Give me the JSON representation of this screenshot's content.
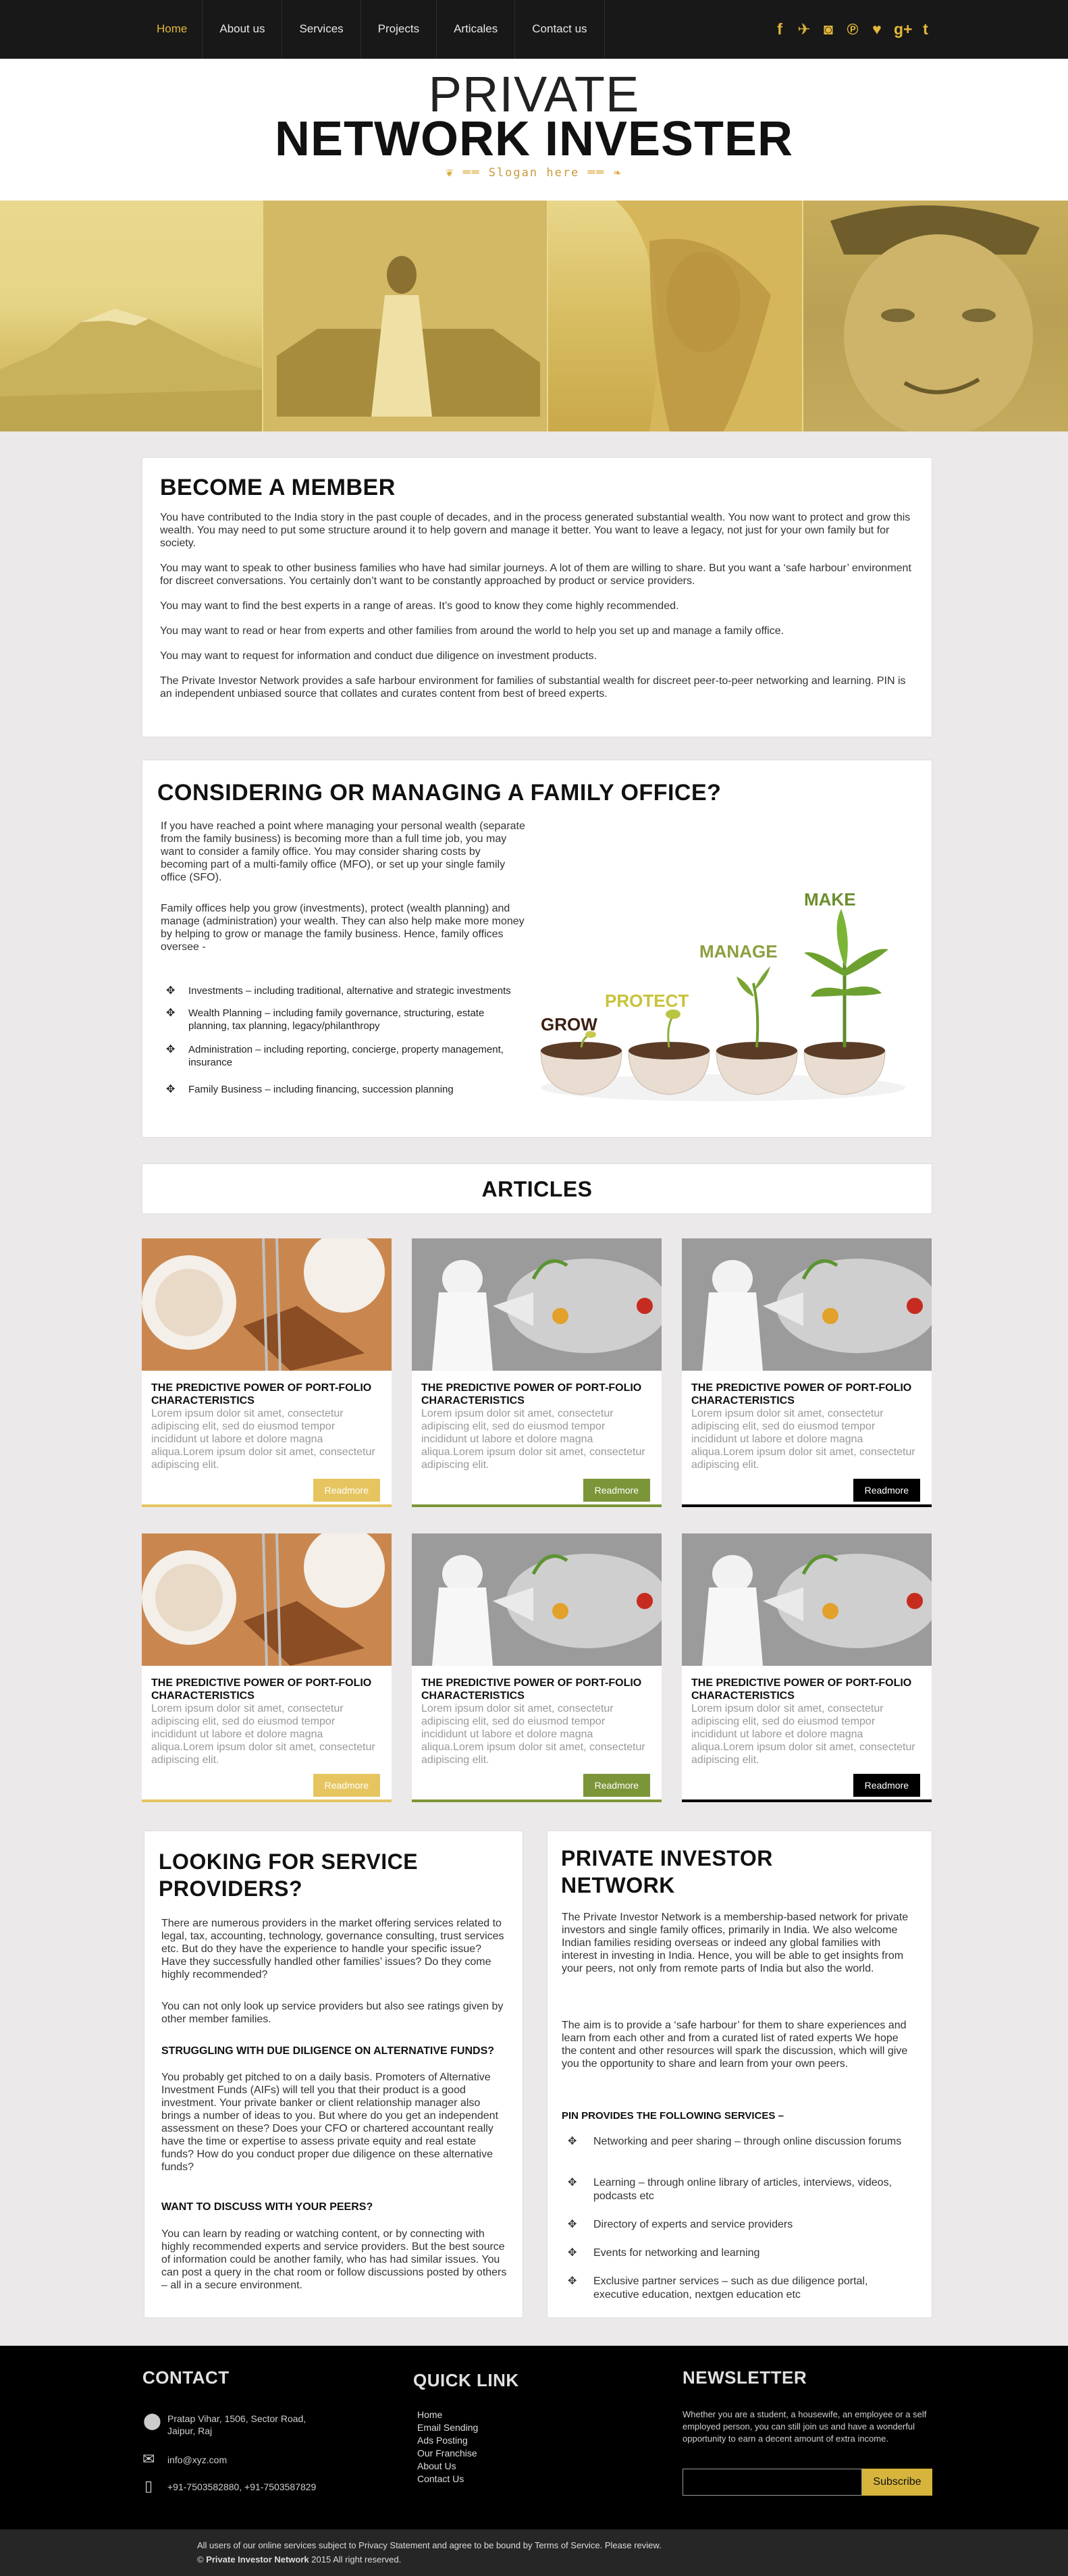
{
  "nav": {
    "items": [
      "Home",
      "About us",
      "Services",
      "Projects",
      "Articales",
      "Contact us"
    ]
  },
  "social": [
    {
      "icon": "facebook-icon",
      "glyph": "f"
    },
    {
      "icon": "twitter-icon",
      "glyph": "✈"
    },
    {
      "icon": "instagram-icon",
      "glyph": "◙"
    },
    {
      "icon": "pinterest-icon",
      "glyph": "℗"
    },
    {
      "icon": "heart-icon",
      "glyph": "♥"
    },
    {
      "icon": "google-plus-icon",
      "glyph": "g+"
    },
    {
      "icon": "tumblr-icon",
      "glyph": "t"
    }
  ],
  "header": {
    "brand_top": "PRIVATE",
    "brand_bottom": "NETWORK INVESTER",
    "slogan": "Slogan here"
  },
  "member": {
    "title": "BECOME A MEMBER",
    "paragraphs": [
      "You have contributed to the India story in the past couple of decades, and in the process generated substantial wealth. You now want to protect and grow this wealth. You may need to put some structure around it to help govern and manage it better. You want to leave a legacy, not just for your own family but for society.",
      "You may want to speak to other business families who have had similar journeys. A lot of them are willing to share. But you want a ‘safe harbour’ environment for discreet conversations. You certainly don’t want to be constantly approached by product or service providers.",
      "You may want to find the best experts in a range of areas. It’s good to know they come highly recommended.",
      "You may want to read or hear from experts and other families from around the world to help you set up and manage a family office.",
      "You may want to request for information and conduct due diligence on investment products.",
      "The Private Investor Network provides a safe harbour environment for families of substantial wealth for discreet peer-to-peer networking and learning. PIN is an independent unbiased source that collates and curates content from best of breed experts."
    ]
  },
  "family": {
    "title": "CONSIDERING OR MANAGING A FAMILY OFFICE?",
    "p1": "If you have reached a point where managing your personal wealth (separate from the family business) is becoming more than a full time job, you may want to consider a family office. You may consider sharing costs by becoming part of a multi-family office (MFO), or set up your single family office (SFO).",
    "p2": "Family offices help you grow (investments), protect (wealth planning) and manage (administration) your wealth. They can also help make more money by helping to grow or manage the family business. Hence, family offices oversee -",
    "items": [
      "Investments – including traditional, alternative and strategic investments",
      "Wealth Planning – including family governance, structuring, estate planning, tax planning, legacy/philanthropy",
      "Administration – including reporting, concierge, property management, insurance",
      "Family Business – including financing, succession planning"
    ],
    "stages": [
      "GROW",
      "PROTECT",
      "MANAGE",
      "MAKE"
    ]
  },
  "articles": {
    "title": "ARTICLES",
    "card_title": "THE PREDICTIVE POWER OF PORT-FOLIO CHARACTERISTICS",
    "card_text": "Lorem ipsum dolor sit amet, consectetur adipiscing elit, sed do eiusmod tempor incididunt ut labore et dolore magna aliqua.Lorem ipsum dolor sit amet, consectetur adipiscing elit.",
    "readmore": "Readmore"
  },
  "service": {
    "title": "LOOKING FOR SERVICE PROVIDERS?",
    "p1": "There are numerous providers in the market offering services related to legal, tax, accounting, technology, governance consulting, trust services etc. But do they have the experience to handle your specific issue? Have they successfully handled other families’ issues? Do they come highly recommended?",
    "p2": "You can not only look up service providers but also see ratings given by other member families.",
    "h1": "STRUGGLING WITH DUE DILIGENCE ON ALTERNATIVE FUNDS?",
    "p3": "You probably get pitched to on a daily basis. Promoters of Alternative Investment Funds (AIFs) will tell you that their product is a good investment. Your private banker or client relationship manager also brings a number of ideas to you. But where do you get an independent assessment on these? Does your CFO or chartered accountant really have the time or expertise to assess private equity and real estate funds? How do you conduct proper due diligence on these alternative funds?",
    "h2": "WANT TO DISCUSS WITH YOUR PEERS?",
    "p4": "You can learn by reading or watching content, or by connecting with highly recommended experts and service providers. But the best source of information could be another family, who has had similar issues. You can post a query in the chat room or follow discussions posted by others – all in a secure environment."
  },
  "network": {
    "title": "PRIVATE INVESTOR NETWORK",
    "p1": "The Private Investor Network is a membership-based network for private investors and single family offices, primarily in India. We also welcome Indian families residing overseas or indeed any global families with interest in investing in India. Hence, you will be able to get insights from your peers, not only from remote parts of India but also the world.",
    "p2": "The aim is to provide a ‘safe harbour’ for them to share experiences and learn from each other and from a curated list of rated experts We hope the content and other resources will spark the discussion, which will give you the opportunity to share and learn from your own peers.",
    "h1": "PIN PROVIDES THE FOLLOWING SERVICES –",
    "services": [
      "Networking and peer sharing – through online discussion forums",
      "Learning – through online library of articles, interviews, videos, podcasts etc",
      "Directory of experts and service providers",
      "Events for networking and learning",
      "Exclusive partner services – such as due diligence portal, executive education, nextgen education etc"
    ]
  },
  "footer": {
    "contact_title": "CONTACT",
    "address": "Pratap Vihar, 1506, Sector Road, Jaipur, Raj",
    "email": "info@xyz.com",
    "phone": "+91-7503582880, +91-7503587829",
    "quick_title": "QUICK LINK",
    "links": [
      "Home",
      "Email Sending",
      "Ads Posting",
      "Our Franchise",
      "About Us",
      "Contact Us"
    ],
    "news_title": "NEWSLETTER",
    "news_text": "Whether you are a student, a housewife, an employee or a self employed person, you can still join us and have a wonderful opportunity to earn a decent amount of extra income.",
    "subscribe": "Subscribe",
    "legal1": "All users of our online services subject to Privacy Statement and agree to be bound by Terms of Service. Please review.",
    "legal2_prefix": "© ",
    "legal2_brand": "Private Investor Network",
    "legal2_suffix": " 2015 All right reserved."
  },
  "colors": {
    "accent": "#e2b83a",
    "green": "#7c9538",
    "dark": "#181818"
  }
}
